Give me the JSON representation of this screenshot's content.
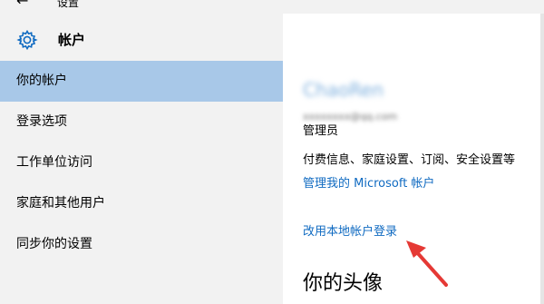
{
  "window": {
    "title": "设置",
    "back_icon": "arrow-left-icon"
  },
  "header": {
    "icon": "gear-icon",
    "title": "帐户",
    "accent": "#0f6ac1"
  },
  "sidebar": {
    "selected_color": "#a8c8e8",
    "items": [
      {
        "label": "你的帐户",
        "selected": true
      },
      {
        "label": "登录选项"
      },
      {
        "label": "工作单位访问"
      },
      {
        "label": "家庭和其他用户"
      },
      {
        "label": "同步你的设置"
      }
    ]
  },
  "main": {
    "account_name": "ChaoRen",
    "account_email": "xxxxxxxx@qq.com",
    "role": "管理员",
    "info_line": "付费信息、家庭设置、订阅、安全设置等",
    "manage_link": "管理我的 Microsoft 帐户",
    "local_login_link": "改用本地帐户登录",
    "avatar_section_title": "你的头像"
  },
  "annotation": {
    "icon": "red-arrow-icon",
    "color": "#e53935"
  }
}
